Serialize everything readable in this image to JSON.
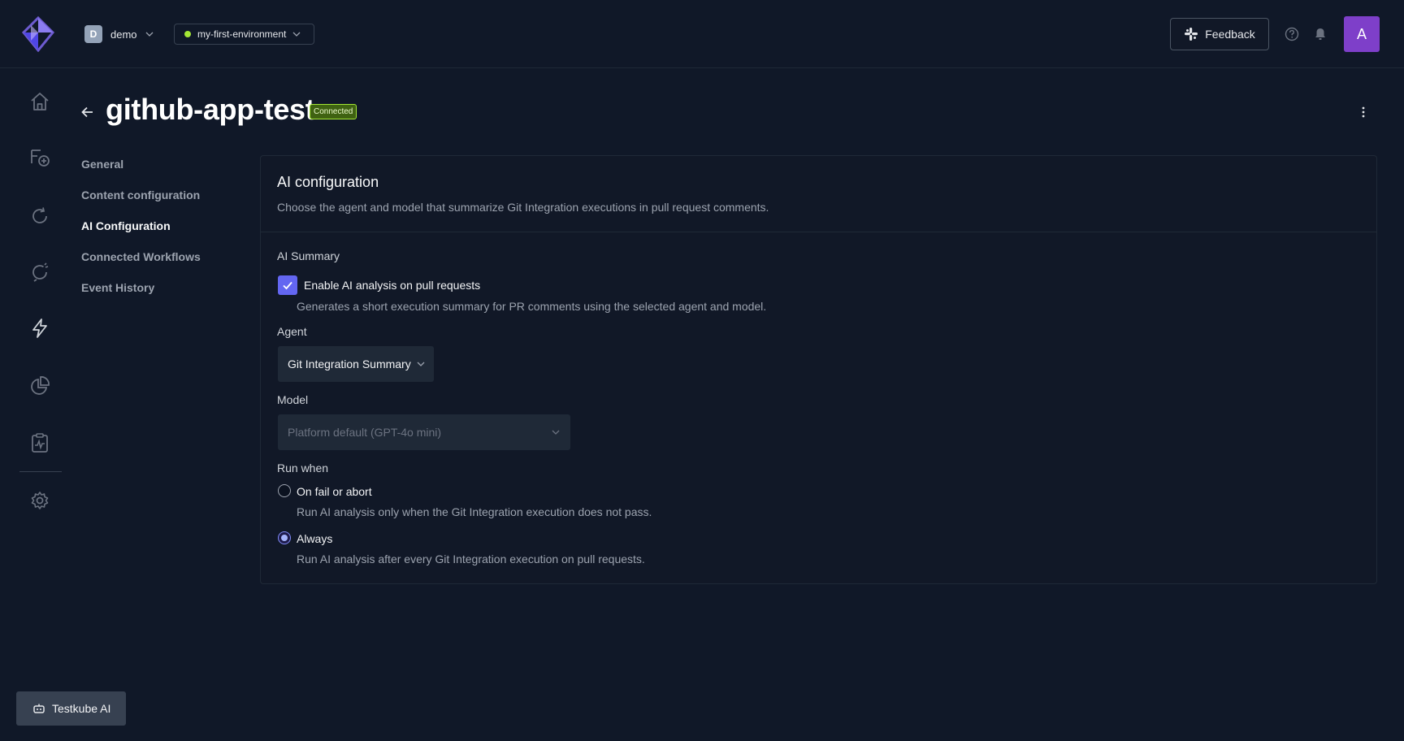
{
  "header": {
    "org": {
      "initial": "D",
      "name": "demo"
    },
    "environment": {
      "name": "my-first-environment"
    },
    "feedback_label": "Feedback",
    "avatar_initial": "A",
    "icons": [
      "help-icon",
      "bell-icon"
    ]
  },
  "left_nav": {
    "items": [
      "home-icon",
      "add-workflow-icon",
      "refresh-icon",
      "executions-icon",
      "triggers-icon",
      "analytics-icon",
      "reports-icon",
      "settings-icon"
    ]
  },
  "page": {
    "title": "github-app-test",
    "status": "Connected"
  },
  "subnav": {
    "items": [
      {
        "label": "General",
        "active": false
      },
      {
        "label": "Content configuration",
        "active": false
      },
      {
        "label": "AI Configuration",
        "active": true
      },
      {
        "label": "Connected Workflows",
        "active": false
      },
      {
        "label": "Event History",
        "active": false
      }
    ]
  },
  "card": {
    "title": "AI configuration",
    "description": "Choose the agent and model that summarize Git Integration executions in pull request comments.",
    "ai_summary": {
      "label": "AI Summary",
      "checkbox_label": "Enable AI analysis on pull requests",
      "checkbox_checked": true,
      "checkbox_help": "Generates a short execution summary for PR comments using the selected agent and model."
    },
    "agent": {
      "label": "Agent",
      "value": "Git Integration Summary"
    },
    "model": {
      "label": "Model",
      "value": "Platform default (GPT-4o mini)"
    },
    "run_when": {
      "label": "Run when",
      "options": [
        {
          "label": "On fail or abort",
          "help": "Run AI analysis only when the Git Integration execution does not pass.",
          "selected": false
        },
        {
          "label": "Always",
          "help": "Run AI analysis after every Git Integration execution on pull requests.",
          "selected": true
        }
      ]
    }
  },
  "assistant_button": "Testkube AI",
  "colors": {
    "background": "#101828",
    "accent": "#6366f1",
    "status_green": "#a3e635",
    "avatar_purple": "#7e3fc9"
  }
}
